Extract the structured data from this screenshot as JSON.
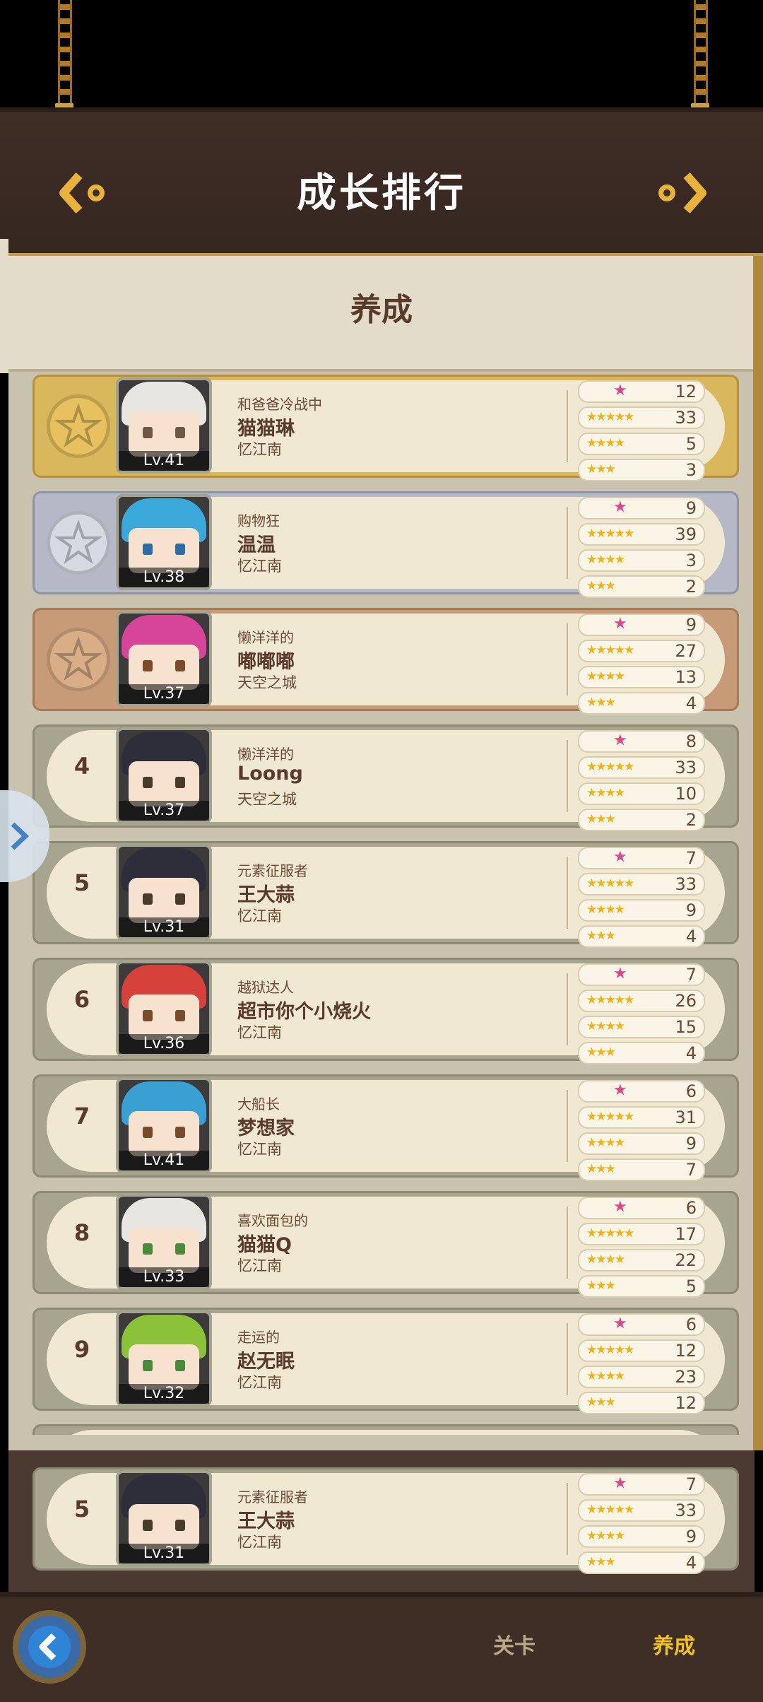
{
  "header": {
    "title": "成长排行"
  },
  "tab_header": "养成",
  "rows": [
    {
      "rank": "1",
      "title": "和爸爸冷战中",
      "name": "猫猫琳",
      "server": "忆江南",
      "level": "Lv.41",
      "stats": [
        "12",
        "33",
        "5",
        "3"
      ],
      "hair": "#e8e6e1",
      "eye": "#6e5a42"
    },
    {
      "rank": "2",
      "title": "购物狂",
      "name": "温温",
      "server": "忆江南",
      "level": "Lv.38",
      "stats": [
        "9",
        "39",
        "3",
        "2"
      ],
      "hair": "#3aa9d9",
      "eye": "#2d6aa8"
    },
    {
      "rank": "3",
      "title": "懒洋洋的",
      "name": "嘟嘟嘟",
      "server": "天空之城",
      "level": "Lv.37",
      "stats": [
        "9",
        "27",
        "13",
        "4"
      ],
      "hair": "#d7459a",
      "eye": "#7a4b2a"
    },
    {
      "rank": "4",
      "title": "懒洋洋的",
      "name": "Loong",
      "server": "天空之城",
      "level": "Lv.37",
      "stats": [
        "8",
        "33",
        "10",
        "2"
      ],
      "hair": "#2e2e3a",
      "eye": "#4a3a2a"
    },
    {
      "rank": "5",
      "title": "元素征服者",
      "name": "王大蒜",
      "server": "忆江南",
      "level": "Lv.31",
      "stats": [
        "7",
        "33",
        "9",
        "4"
      ],
      "hair": "#2e2e3a",
      "eye": "#4a3a2a"
    },
    {
      "rank": "6",
      "title": "越狱达人",
      "name": "超市你个小烧火",
      "server": "忆江南",
      "level": "Lv.36",
      "stats": [
        "7",
        "26",
        "15",
        "4"
      ],
      "hair": "#d6423a",
      "eye": "#7a4b2a"
    },
    {
      "rank": "7",
      "title": "大船长",
      "name": "梦想家",
      "server": "忆江南",
      "level": "Lv.41",
      "stats": [
        "6",
        "31",
        "9",
        "7"
      ],
      "hair": "#3aa0d4",
      "eye": "#7a4b2a"
    },
    {
      "rank": "8",
      "title": "喜欢面包的",
      "name": "猫猫Q",
      "server": "忆江南",
      "level": "Lv.33",
      "stats": [
        "6",
        "17",
        "22",
        "5"
      ],
      "hair": "#e8e6e1",
      "eye": "#4a8a3a"
    },
    {
      "rank": "9",
      "title": "走运的",
      "name": "赵无眠",
      "server": "忆江南",
      "level": "Lv.32",
      "stats": [
        "6",
        "12",
        "23",
        "12"
      ],
      "hair": "#8cc23a",
      "eye": "#4a8a3a"
    }
  ],
  "self_row": {
    "rank": "5",
    "title": "元素征服者",
    "name": "王大蒜",
    "server": "忆江南",
    "level": "Lv.31",
    "stats": [
      "7",
      "33",
      "9",
      "4"
    ],
    "hair": "#2e2e3a",
    "eye": "#4a3a2a"
  },
  "footer": {
    "tab_stage": "关卡",
    "tab_cultivate": "养成"
  },
  "colors": {
    "active_tab": "#f2c21a",
    "inactive_tab": "#b9a98a"
  },
  "icons": [
    "left-arrow-gear-icon",
    "right-arrow-gear-icon",
    "back-icon",
    "expand-icon",
    "star-icon",
    "pink-star-icon"
  ]
}
